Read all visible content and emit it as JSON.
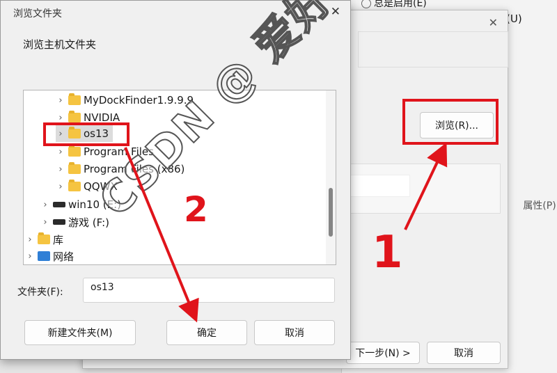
{
  "background_window": {
    "top_radio_label": "总是启用(E)",
    "right_label": "(U)",
    "browse_button": "浏览(R)...",
    "properties_button": "属性(P)",
    "next_button": "下一步(N) >",
    "cancel_button": "取消"
  },
  "dialog": {
    "title": "浏览文件夹",
    "header": "浏览主机文件夹",
    "tree": [
      {
        "label": "MyDockFinder1.9.9.9",
        "icon": "folder-icon"
      },
      {
        "label": "NVIDIA",
        "icon": "folder-icon"
      },
      {
        "label": "os13",
        "icon": "folder-icon",
        "selected": true
      },
      {
        "label": "Program Files",
        "icon": "folder-icon"
      },
      {
        "label": "Program Files (x86)",
        "icon": "folder-icon"
      },
      {
        "label": "QQWX",
        "icon": "folder-icon"
      },
      {
        "label": "win10 (E:)",
        "icon": "drive-icon"
      },
      {
        "label": "游戏 (F:)",
        "icon": "drive-icon"
      },
      {
        "label": "库",
        "icon": "folder-icon"
      },
      {
        "label": "网络",
        "icon": "network-icon"
      }
    ],
    "folder_label": "文件夹(F):",
    "folder_value": "os13",
    "new_folder_button": "新建文件夹(M)",
    "ok_button": "确定",
    "cancel_button": "取消",
    "close_glyph": "✕"
  },
  "annotations": {
    "marker_1": "1",
    "marker_2": "2",
    "accent_color": "#e0141b"
  },
  "watermark": "CSDN @ 爱好软件"
}
